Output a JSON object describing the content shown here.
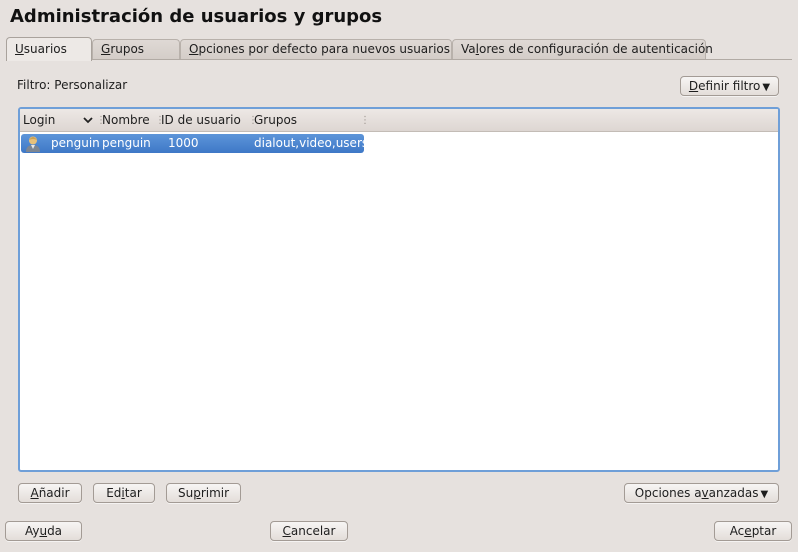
{
  "title": "Administración de usuarios y grupos",
  "tabs": [
    {
      "pre": "",
      "u": "U",
      "post": "suarios"
    },
    {
      "pre": "",
      "u": "G",
      "post": "rupos"
    },
    {
      "pre": "",
      "u": "O",
      "post": "pciones por defecto para nuevos usuarios"
    },
    {
      "pre": "Va",
      "u": "l",
      "post": "ores de configuración de autenticación"
    }
  ],
  "filter_label": "Filtro: Personalizar",
  "define_filter": {
    "pre": "",
    "u": "D",
    "post": "efinir filtro"
  },
  "table": {
    "columns": [
      "Login",
      "Nombre",
      "ID de usuario",
      "Grupos"
    ],
    "rows": [
      {
        "login": "penguin",
        "name": "penguin",
        "uid": "1000",
        "groups": "dialout,video,users",
        "icon": "user-icon"
      }
    ]
  },
  "buttons": {
    "add": {
      "pre": "",
      "u": "A",
      "post": "ñadir"
    },
    "edit": {
      "pre": "Ed",
      "u": "i",
      "post": "tar"
    },
    "delete": {
      "pre": "Su",
      "u": "p",
      "post": "rimir"
    },
    "expert": {
      "pre": "Opciones a",
      "u": "v",
      "post": "anzadas"
    },
    "help": {
      "pre": "Ay",
      "u": "u",
      "post": "da"
    },
    "cancel": {
      "pre": "",
      "u": "C",
      "post": "ancelar"
    },
    "accept": {
      "pre": "Ac",
      "u": "e",
      "post": "ptar"
    }
  },
  "colors": {
    "selection": "#4a85cf",
    "focus_border": "#6f9fd8",
    "window_bg": "#e6e1de"
  }
}
